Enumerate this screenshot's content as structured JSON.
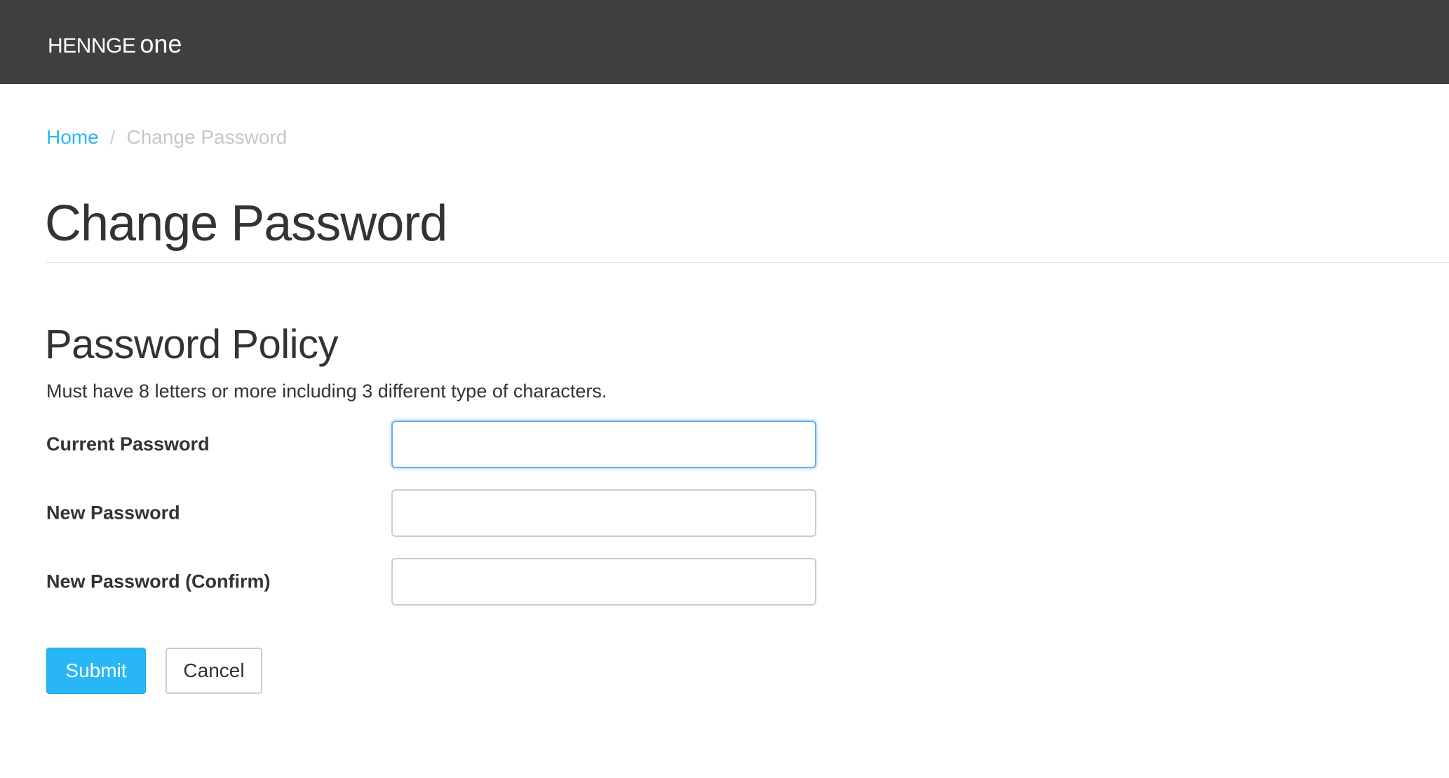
{
  "header": {
    "brand_main": "HENNGE",
    "brand_sub": "one",
    "background_color": "#3f3f3f"
  },
  "breadcrumb": {
    "home": "Home",
    "separator": "/",
    "current": "Change Password"
  },
  "page": {
    "title": "Change Password"
  },
  "policy": {
    "heading": "Password Policy",
    "description": "Must have 8 letters or more including 3 different type of characters."
  },
  "form": {
    "current_password": {
      "label": "Current Password",
      "value": ""
    },
    "new_password": {
      "label": "New Password",
      "value": ""
    },
    "confirm_password": {
      "label": "New Password (Confirm)",
      "value": ""
    }
  },
  "actions": {
    "submit_label": "Submit",
    "cancel_label": "Cancel",
    "accent_color": "#29b6f6"
  }
}
